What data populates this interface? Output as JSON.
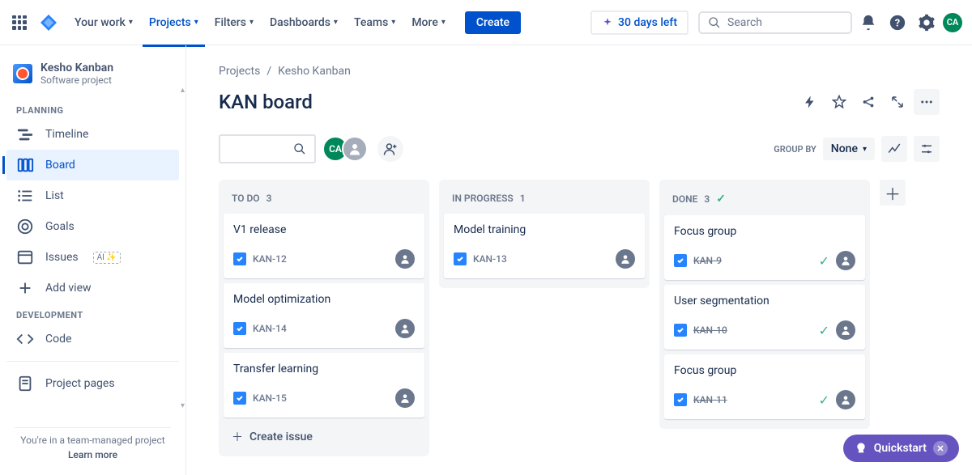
{
  "nav": {
    "yourwork": "Your work",
    "projects": "Projects",
    "filters": "Filters",
    "dashboards": "Dashboards",
    "teams": "Teams",
    "more": "More",
    "create": "Create",
    "trial": "30 days left",
    "search_placeholder": "Search",
    "avatar_initials": "CA"
  },
  "sidebar": {
    "project_name": "Kesho Kanban",
    "project_type": "Software project",
    "section_planning": "PLANNING",
    "timeline": "Timeline",
    "board": "Board",
    "list": "List",
    "goals": "Goals",
    "issues": "Issues",
    "ai_badge": "AI ✨",
    "add_view": "Add view",
    "section_dev": "DEVELOPMENT",
    "code": "Code",
    "project_pages": "Project pages",
    "footer_text": "You're in a team-managed project",
    "learn_more": "Learn more"
  },
  "breadcrumb": {
    "projects": "Projects",
    "project": "Kesho Kanban"
  },
  "page": {
    "title": "KAN board"
  },
  "toolbar": {
    "avatar_initials": "CA",
    "group_by_label": "GROUP BY",
    "group_by_value": "None"
  },
  "columns": {
    "todo": {
      "label": "TO DO",
      "count": "3"
    },
    "inprogress": {
      "label": "IN PROGRESS",
      "count": "1"
    },
    "done": {
      "label": "DONE",
      "count": "3"
    }
  },
  "cards": {
    "kan12": {
      "title": "V1 release",
      "key": "KAN-12"
    },
    "kan14": {
      "title": "Model optimization",
      "key": "KAN-14"
    },
    "kan15": {
      "title": "Transfer learning",
      "key": "KAN-15"
    },
    "kan13": {
      "title": "Model training",
      "key": "KAN-13"
    },
    "kan9": {
      "title": "Focus group",
      "key": "KAN-9"
    },
    "kan10": {
      "title": "User segmentation",
      "key": "KAN-10"
    },
    "kan11": {
      "title": "Focus group",
      "key": "KAN-11"
    }
  },
  "create_issue": "Create issue",
  "quickstart": "Quickstart"
}
